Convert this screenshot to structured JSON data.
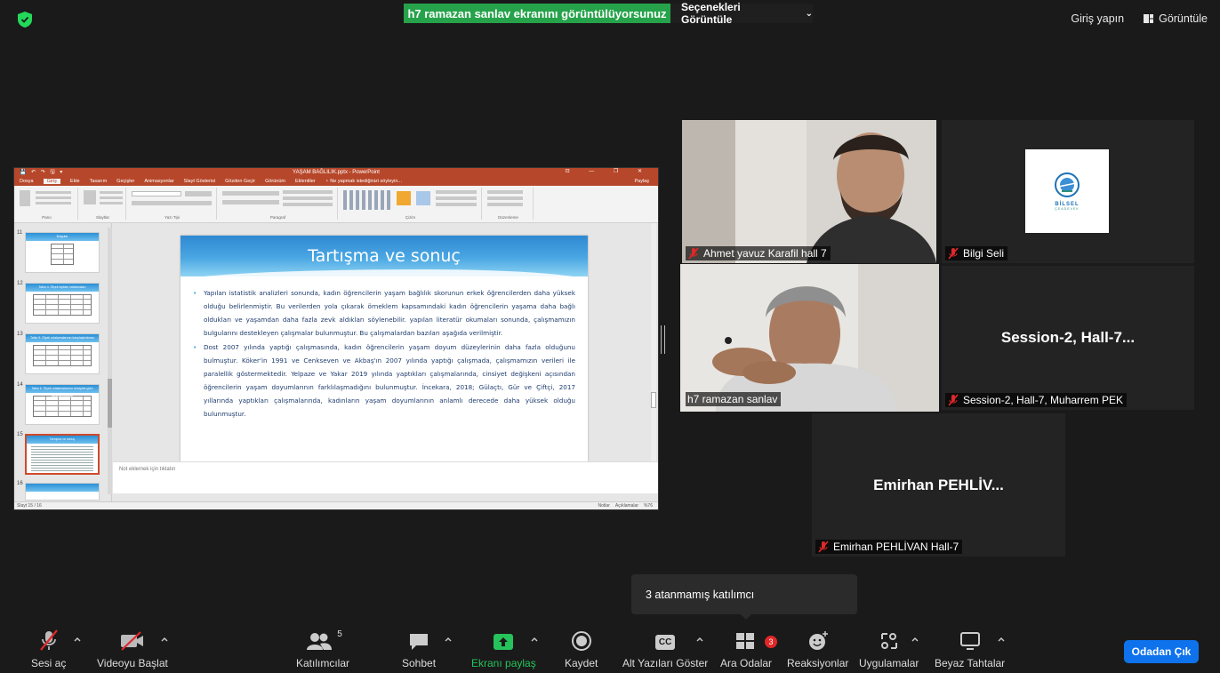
{
  "top_bar": {
    "share_banner": "h7 ramazan sanlav ekranını görüntülüyorsunuz",
    "view_options_label": "Seçenekleri Görüntüle",
    "sign_in_label": "Giriş yapın",
    "view_label": "Görüntüle",
    "shield_color": "#23d959"
  },
  "powerpoint": {
    "window_title": "YAŞAM BAĞLILIK.pptx - PowerPoint",
    "quick_access": "💾 ↶ ↷ 🖫 ▾",
    "window_controls": "⊡ — ❐ ✕",
    "tabs": [
      "Dosya",
      "Giriş",
      "Ekle",
      "Tasarım",
      "Geçişler",
      "Animasyonlar",
      "Slayt Gösterisi",
      "Gözden Geçir",
      "Görünüm",
      "Eklentiler",
      "♀ Ne yapmak istediğinizi söyleyin..."
    ],
    "share_label": "Paylaş",
    "ribbon_groups": [
      "Pano",
      "Slaytlar",
      "Yazı Tipi",
      "Paragraf",
      "Çizim",
      "Düzenleme"
    ],
    "thumbnails": [
      {
        "num": "11",
        "title": "Bulgular"
      },
      {
        "num": "12",
        "title": "Tablo 4. Ölçek toplam ortalamaları"
      },
      {
        "num": "13",
        "title": "Tablo 5. Ölçek ortalamalarının karşılaştırılması"
      },
      {
        "num": "14",
        "title": "Tablo 6. Ölçek ortalamalarının cinsiyete göre karşılaştırılması"
      },
      {
        "num": "15",
        "title": "Tartışma ve sonuç"
      },
      {
        "num": "16",
        "title": ""
      }
    ],
    "slide": {
      "title": "Tartışma ve sonuç",
      "bullet1": "Yapılan istatistik analizleri sonunda, kadın öğrencilerin yaşam bağlılık skorunun erkek öğrencilerden daha yüksek olduğu belirlenmiştir. Bu verilerden yola çıkarak örneklem kapsamındaki kadın öğrencilerin yaşama daha bağlı oldukları ve yaşamdan daha fazla zevk aldıkları söylenebilir. yapılan literatür okumaları sonunda, çalışmamızın bulgularını destekleyen çalışmalar bulunmuştur. Bu çalışmalardan bazıları aşağıda verilmiştir.",
      "bullet2": "Dost 2007 yılında yaptığı çalışmasında, kadın öğrencilerin yaşam doyum düzeylerinin daha fazla olduğunu bulmuştur. Köker'in 1991 ve Cenkseven ve Akbaş'ın 2007 yılında yaptığı çalışmada, çalışmamızın verileri ile paralellik göstermektedir. Yelpaze ve Yakar 2019 yılında yaptıkları çalışmalarında, cinsiyet değişkeni açısından öğrencilerin yaşam doyumlarının farklılaşmadığını bulunmuştur. İncekara, 2018; Gülaçtı, Gür ve Çiftçi, 2017 yıllarında yaptıkları çalışmalarında, kadınların yaşam doyumlarının anlamlı derecede daha yüksek olduğu bulunmuştur."
    },
    "notes_placeholder": "Not eklemek için tıklatın",
    "status_left": "Slayt 15 / 16",
    "status_notes": "Notlar",
    "status_comments": "Açıklamalar",
    "zoom": "%76"
  },
  "participants": [
    {
      "name": "Ahmet yavuz Karafil hall 7",
      "muted": true
    },
    {
      "name": "Bilgi Seli",
      "muted": true,
      "logo_text": "BİLSEL",
      "logo_sub": "ÇEADEVEK"
    },
    {
      "name": "h7 ramazan sanlav",
      "muted": false
    },
    {
      "name": "Session-2, Hall-7, Muharrem PEK",
      "display": "Session-2, Hall-7...",
      "muted": true
    },
    {
      "name": "Emirhan PEHLİVAN Hall-7",
      "display": "Emirhan PEHLİV...",
      "muted": true
    }
  ],
  "tooltip": "3 atanmamış katılımcı",
  "toolbar": {
    "unmute": "Sesi aç",
    "start_video": "Videoyu Başlat",
    "participants": "Katılımcılar",
    "participants_count": "5",
    "chat": "Sohbet",
    "share_screen": "Ekranı paylaş",
    "record": "Kaydet",
    "captions": "Alt Yazıları Göster",
    "captions_icon_text": "CC",
    "breakout": "Ara Odalar",
    "breakout_badge": "3",
    "reactions": "Reaksiyonlar",
    "apps": "Uygulamalar",
    "whiteboards": "Beyaz Tahtalar",
    "leave": "Odadan Çık",
    "share_color": "#26c25b",
    "leave_color": "#0e72ed",
    "mute_red": "#e02828"
  }
}
